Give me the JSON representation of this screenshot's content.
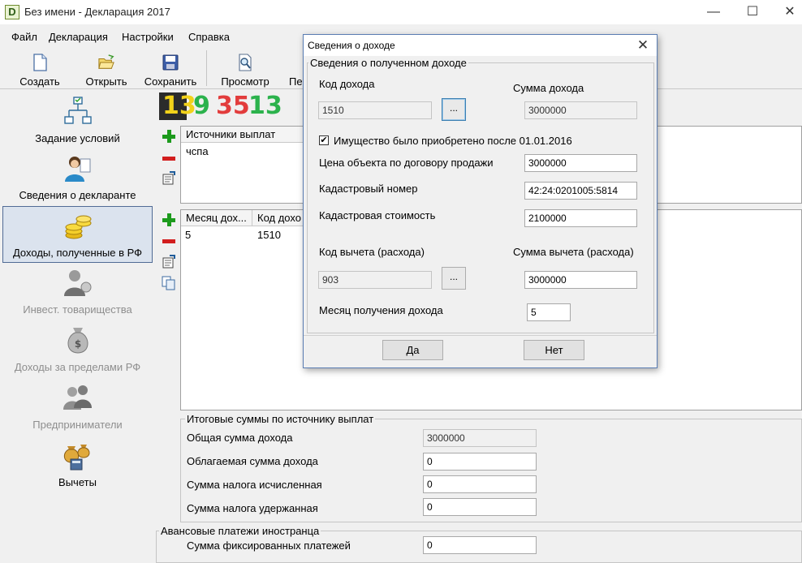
{
  "window": {
    "title": "Без имени - Декларация 2017",
    "app_icon": "D",
    "minimize": "—",
    "maximize": "☐",
    "close": "✕"
  },
  "menu": {
    "file": "Файл",
    "declaration": "Декларация",
    "settings": "Настройки",
    "help": "Справка"
  },
  "toolbar": {
    "create": "Создать",
    "open": "Открыть",
    "save": "Сохранить",
    "preview": "Просмотр",
    "print_partial": "Пе"
  },
  "nav": {
    "items": [
      {
        "label": "Задание условий",
        "icon": "hierarchy-icon"
      },
      {
        "label": "Сведения о декларанте",
        "icon": "person-icon"
      },
      {
        "label": "Доходы, полученные в РФ",
        "icon": "coins-icon"
      },
      {
        "label": "Инвест. товарищества",
        "icon": "investor-icon"
      },
      {
        "label": "Доходы за пределами РФ",
        "icon": "money-bag-icon"
      },
      {
        "label": "Предприниматели",
        "icon": "entrepreneurs-icon"
      },
      {
        "label": "Вычеты",
        "icon": "deductions-icon"
      }
    ]
  },
  "brand": {
    "n1": "13",
    "n2": "9",
    "n3": "35",
    "n4": "13",
    "colors": [
      "#f2d21a",
      "#2bb24c",
      "#e23c3c",
      "#2bb24c"
    ]
  },
  "sources": {
    "header": "Источники выплат",
    "rows": [
      "чспа"
    ]
  },
  "income_grid": {
    "headers": [
      "Месяц дох...",
      "Код дохо"
    ],
    "rows": [
      [
        "5",
        "1510"
      ]
    ]
  },
  "totals": {
    "group_title": "Итоговые суммы по источнику выплат",
    "total_income_label": "Общая сумма дохода",
    "total_income": "3000000",
    "taxable_label": "Облагаемая сумма дохода",
    "taxable": "0",
    "tax_calc_label": "Сумма налога исчисленная",
    "tax_calc": "0",
    "tax_withheld_label": "Сумма налога удержанная",
    "tax_withheld": "0"
  },
  "advance": {
    "group_title": "Авансовые платежи иностранца",
    "fixed_label": "Сумма фиксированных платежей",
    "fixed": "0"
  },
  "dialog": {
    "title": "Сведения о доходе",
    "group_title": "Сведения о полученном доходе",
    "income_code_label": "Код дохода",
    "income_code": "1510",
    "income_amount_label": "Сумма дохода",
    "income_amount": "3000000",
    "property_checkbox_label": "Имущество было приобретено после 01.01.2016",
    "property_checked": true,
    "contract_price_label": "Цена объекта по договору продажи",
    "contract_price": "3000000",
    "cadastral_number_label": "Кадастровый номер",
    "cadastral_number": "42:24:0201005:5814",
    "cadastral_value_label": "Кадастровая стоимость",
    "cadastral_value": "2100000",
    "deduction_code_label": "Код вычета (расхода)",
    "deduction_code": "903",
    "deduction_amount_label": "Сумма вычета (расхода)",
    "deduction_amount": "3000000",
    "income_month_label": "Месяц получения дохода",
    "income_month": "5",
    "browse": "...",
    "yes": "Да",
    "no": "Нет"
  }
}
